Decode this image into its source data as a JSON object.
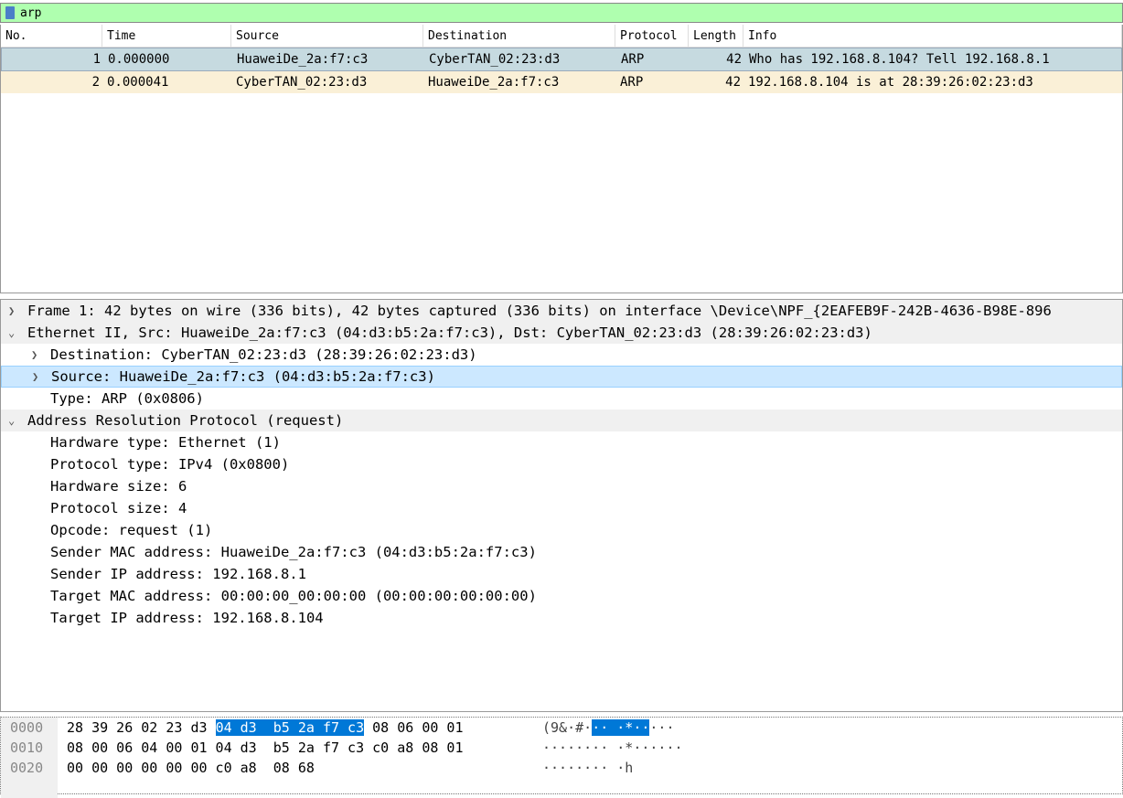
{
  "filter": {
    "value": "arp"
  },
  "packet_list": {
    "columns": [
      "No.",
      "Time",
      "Source",
      "Destination",
      "Protocol",
      "Length",
      "Info"
    ],
    "rows": [
      [
        "1",
        "0.000000",
        "HuaweiDe_2a:f7:c3",
        "CyberTAN_02:23:d3",
        "ARP",
        "42",
        "Who has 192.168.8.104? Tell 192.168.8.1"
      ],
      [
        "2",
        "0.000041",
        "CyberTAN_02:23:d3",
        "HuaweiDe_2a:f7:c3",
        "ARP",
        "42",
        "192.168.8.104 is at 28:39:26:02:23:d3"
      ]
    ]
  },
  "details": [
    "Frame 1: 42 bytes on wire (336 bits), 42 bytes captured (336 bits) on interface \\Device\\NPF_{2EAFEB9F-242B-4636-B98E-896",
    "Ethernet II, Src: HuaweiDe_2a:f7:c3 (04:d3:b5:2a:f7:c3), Dst: CyberTAN_02:23:d3 (28:39:26:02:23:d3)",
    "Destination: CyberTAN_02:23:d3 (28:39:26:02:23:d3)",
    "Source: HuaweiDe_2a:f7:c3 (04:d3:b5:2a:f7:c3)",
    "Type: ARP (0x0806)",
    "Address Resolution Protocol (request)",
    "Hardware type: Ethernet (1)",
    "Protocol type: IPv4 (0x0800)",
    "Hardware size: 6",
    "Protocol size: 4",
    "Opcode: request (1)",
    "Sender MAC address: HuaweiDe_2a:f7:c3 (04:d3:b5:2a:f7:c3)",
    "Sender IP address: 192.168.8.1",
    "Target MAC address: 00:00:00_00:00:00 (00:00:00:00:00:00)",
    "Target IP address: 192.168.8.104"
  ],
  "hex": [
    {
      "offset": "0000",
      "pre": "28 39 26 02 23 d3 ",
      "hl": "04 d3  b5 2a f7 c3",
      "post": " 08 06 00 01",
      "apre": "(9&·#·",
      "ahl": "·· ·*··",
      "apost": "···"
    },
    {
      "offset": "0010",
      "pre": "08 00 06 04 00 01 04 d3  b5 2a f7 c3 c0 a8 08 01",
      "hl": "",
      "post": "",
      "apre": "········ ·*······",
      "ahl": "",
      "apost": ""
    },
    {
      "offset": "0020",
      "pre": "00 00 00 00 00 00 c0 a8  08 68",
      "hl": "",
      "post": "",
      "apre": "········ ·h",
      "ahl": "",
      "apost": ""
    }
  ]
}
